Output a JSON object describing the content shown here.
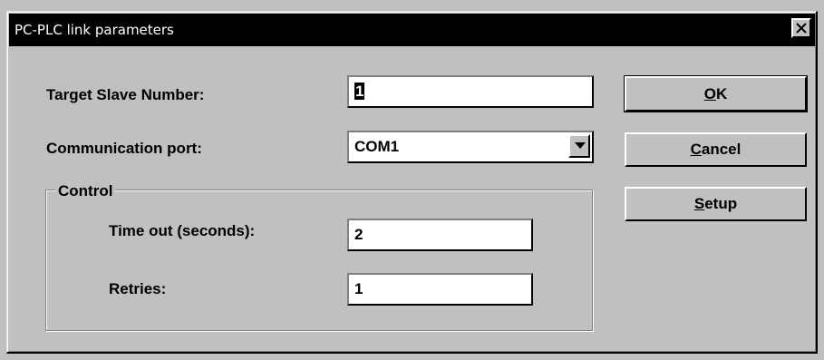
{
  "window": {
    "title": "PC-PLC link parameters",
    "close_icon": "close-icon"
  },
  "form": {
    "target_slave_label": "Target Slave Number:",
    "target_slave_value": "1",
    "comm_port_label": "Communication port:",
    "comm_port_value": "COM1",
    "dropdown_icon": "chevron-down-icon"
  },
  "control": {
    "group_label": "Control",
    "timeout_label": "Time out (seconds):",
    "timeout_value": "2",
    "retries_label": "Retries:",
    "retries_value": "1"
  },
  "buttons": {
    "ok_mnemonic": "O",
    "ok_rest": "K",
    "cancel_mnemonic": "C",
    "cancel_rest": "ancel",
    "setup_mnemonic": "S",
    "setup_rest": "etup"
  }
}
